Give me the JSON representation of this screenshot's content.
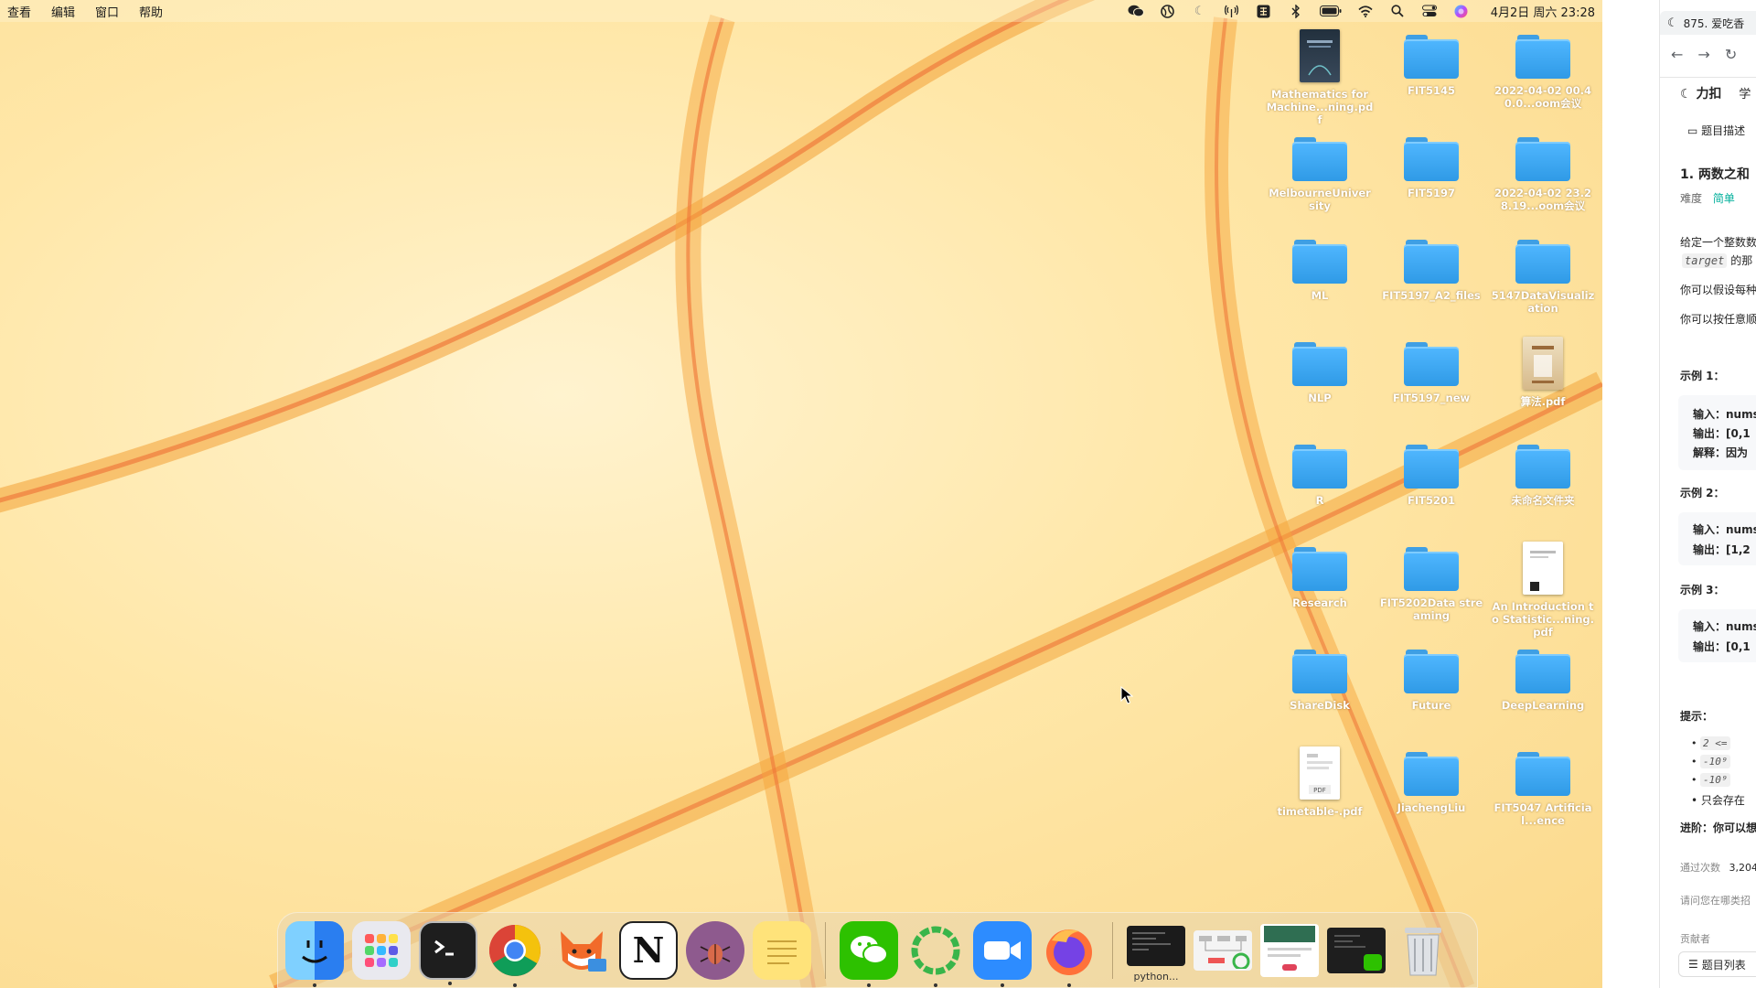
{
  "menubar": {
    "menus": [
      "查看",
      "编辑",
      "窗口",
      "帮助"
    ],
    "clock": "4月2日 周六  23:28",
    "status_icons": [
      "wechat-icon",
      "vpn-icon",
      "moon-icon",
      "antenna-icon",
      "input-method-icon",
      "bluetooth-icon",
      "battery-icon",
      "wifi-icon",
      "spotlight-icon",
      "control-center-icon",
      "siri-icon"
    ]
  },
  "desktop": {
    "items": [
      {
        "label": "Mathematics for Machine...ning.pdf",
        "kind": "doc-dark"
      },
      {
        "label": "FIT5145",
        "kind": "folder"
      },
      {
        "label": "2022-04-02 00.40.0...oom会议",
        "kind": "folder"
      },
      {
        "label": "MelbourneUniversity",
        "kind": "folder"
      },
      {
        "label": "FIT5197",
        "kind": "folder"
      },
      {
        "label": "2022-04-02 23.28.19...oom会议",
        "kind": "folder"
      },
      {
        "label": "ML",
        "kind": "folder"
      },
      {
        "label": "FIT5197_A2_files",
        "kind": "folder"
      },
      {
        "label": "5147DataVisualization",
        "kind": "folder"
      },
      {
        "label": "NLP",
        "kind": "folder"
      },
      {
        "label": "FIT5197_new",
        "kind": "folder"
      },
      {
        "label": "算法.pdf",
        "kind": "doc-tan"
      },
      {
        "label": "R",
        "kind": "folder"
      },
      {
        "label": "FIT5201",
        "kind": "folder"
      },
      {
        "label": "未命名文件夹",
        "kind": "folder"
      },
      {
        "label": "Research",
        "kind": "folder"
      },
      {
        "label": "FIT5202Data streaming",
        "kind": "folder"
      },
      {
        "label": "An Introduction to Statistic...ning.pdf",
        "kind": "doc"
      },
      {
        "label": "ShareDisk",
        "kind": "folder"
      },
      {
        "label": "Future",
        "kind": "folder"
      },
      {
        "label": "DeepLearning",
        "kind": "folder"
      },
      {
        "label": "timetable-.pdf",
        "kind": "doc-pdf"
      },
      {
        "label": "JiachengLiu",
        "kind": "folder"
      },
      {
        "label": "FIT5047 Artificial...ence",
        "kind": "folder"
      }
    ]
  },
  "dock": {
    "apps": [
      "finder",
      "launchpad",
      "terminal",
      "chrome",
      "foxmail",
      "notion",
      "bug-app",
      "stickies"
    ],
    "apps2": [
      "wechat",
      "ring-app",
      "zoom",
      "firefox"
    ],
    "recent_label": "python...",
    "recent": [
      "python-window",
      "diagram-window",
      "spreadsheet-window",
      "wechat-window"
    ],
    "trash": "trash"
  },
  "browser": {
    "tab_title": "875. 爱吃香",
    "site_logo": "力扣",
    "site_nav": "学",
    "tab_description": "题目描述",
    "problem_title": "1. 两数之和",
    "difficulty_label": "难度",
    "difficulty_value": "简单",
    "desc_line1": "给定一个整数数",
    "desc_code": "target",
    "desc_line2": "的那",
    "desc_line3": "你可以假设每种",
    "desc_line4": "你可以按任意顺",
    "example1_title": "示例 1：",
    "example1_input": "输入：nums",
    "example1_output": "输出：[0,1",
    "example1_explain": "解释：因为",
    "example2_title": "示例 2：",
    "example2_input": "输入：nums",
    "example2_output": "输出：[1,2",
    "example3_title": "示例 3：",
    "example3_input": "输入：nums",
    "example3_output": "输出：[0,1",
    "hints_title": "提示：",
    "hint1": "2 <=",
    "hint2": "-10⁹",
    "hint3": "-10⁹",
    "hint4": "只会存在",
    "advanced": "进阶：你可以想",
    "passed_label": "通过次数",
    "passed_value": "3,204",
    "question": "请问您在哪类招",
    "contributors": "贡献者",
    "list_button": "题目列表"
  }
}
